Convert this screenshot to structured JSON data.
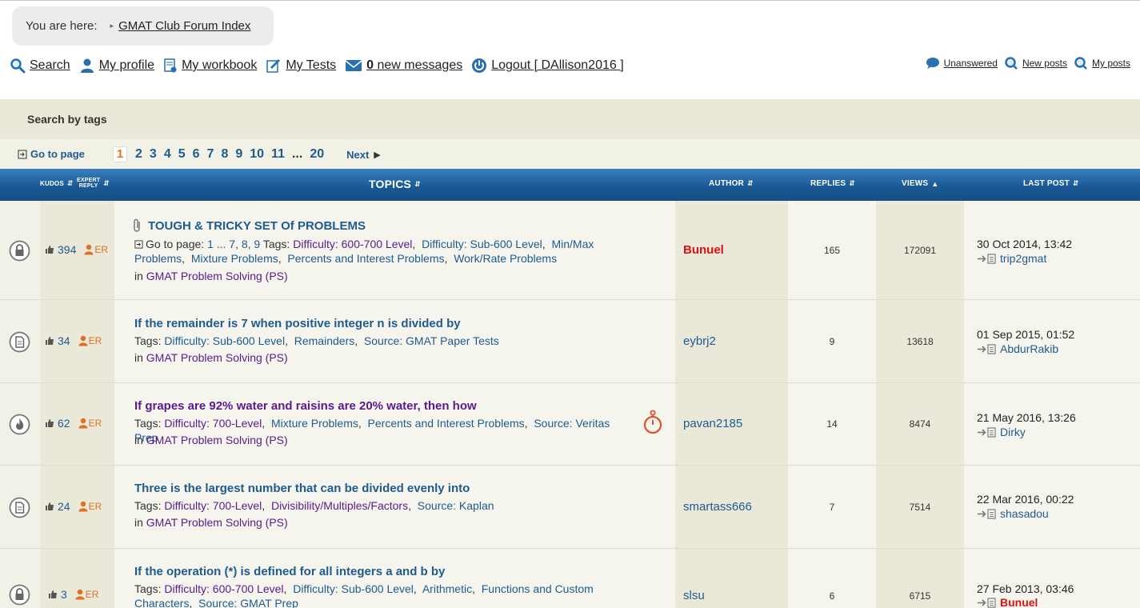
{
  "breadcrumb": {
    "prefix": "You are here:",
    "link": "GMAT Club Forum Index"
  },
  "nav": {
    "search": "Search",
    "profile": "My profile",
    "workbook": "My workbook",
    "tests": "My Tests",
    "messages_count": "0",
    "messages_label": "new messages",
    "logout": "Logout [ DAllison2016 ]"
  },
  "nav_right": {
    "unanswered": "Unanswered",
    "new_posts": "New posts",
    "my_posts": "My posts"
  },
  "search_tags_label": "Search by tags",
  "pager": {
    "goto_label": "Go to page",
    "current": "1",
    "pages": [
      "2",
      "3",
      "4",
      "5",
      "6",
      "7",
      "8",
      "9",
      "10",
      "11"
    ],
    "ellipsis": "...",
    "last": "20",
    "next": "Next"
  },
  "table_header": {
    "kudos": "KUDOS",
    "expert_reply_1": "EXPERT",
    "expert_reply_2": "REPLY",
    "topics": "TOPICS",
    "author": "AUTHOR",
    "replies": "REPLIES",
    "views": "VIEWS",
    "last_post": "LAST POST"
  },
  "rows": [
    {
      "kudos": "394",
      "er": "ER",
      "title": "TOUGH & TRICKY SET Of PROBLEMS",
      "goto_prefix": "Go to page:",
      "goto_pages": "1 ... 7, 8, 9",
      "tags_label": "Tags:",
      "tags": [
        "Difficulty: 600-700 Level",
        "Difficulty: Sub-600 Level",
        "Min/Max Problems",
        "Mixture Problems",
        "Percents and Interest Problems",
        "Work/Rate Problems"
      ],
      "forum_prefix": "in",
      "forum": "GMAT Problem Solving (PS)",
      "author": "Bunuel",
      "replies": "165",
      "views": "172091",
      "last_date": "30 Oct 2014, 13:42",
      "last_user": "trip2gmat"
    },
    {
      "kudos": "34",
      "er": "ER",
      "title": "If the remainder is 7 when positive integer n is divided by",
      "tags_label": "Tags:",
      "tags": [
        "Difficulty: Sub-600 Level",
        "Remainders",
        "Source: GMAT Paper Tests"
      ],
      "forum_prefix": "in",
      "forum": "GMAT Problem Solving (PS)",
      "author": "eybrj2",
      "replies": "9",
      "views": "13618",
      "last_date": "01 Sep 2015, 01:52",
      "last_user": "AbdurRakib"
    },
    {
      "kudos": "62",
      "er": "ER",
      "title": "If grapes are 92% water and raisins are 20% water, then how",
      "tags_label": "Tags:",
      "tags": [
        "Difficulty: 700-Level",
        "Mixture Problems",
        "Percents and Interest Problems",
        "Source: Veritas Prep"
      ],
      "forum_prefix": "in",
      "forum": "GMAT Problem Solving (PS)",
      "author": "pavan2185",
      "replies": "14",
      "views": "8474",
      "last_date": "21 May 2016, 13:26",
      "last_user": "Dirky"
    },
    {
      "kudos": "24",
      "er": "ER",
      "title": "Three is the largest number that can be divided evenly into",
      "tags_label": "Tags:",
      "tags": [
        "Difficulty: 700-Level",
        "Divisibility/Multiples/Factors",
        "Source: Kaplan"
      ],
      "forum_prefix": "in",
      "forum": "GMAT Problem Solving (PS)",
      "author": "smartass666",
      "replies": "7",
      "views": "7514",
      "last_date": "22 Mar 2016, 00:22",
      "last_user": "shasadou"
    },
    {
      "kudos": "3",
      "er": "ER",
      "title": "If the operation (*) is defined for all integers a and b by",
      "tags_label": "Tags:",
      "tags": [
        "Difficulty: 600-700 Level",
        "Difficulty: Sub-600 Level",
        "Arithmetic",
        "Functions and Custom Characters",
        "Source: GMAT Prep"
      ],
      "author": "slsu",
      "replies": "6",
      "views": "6715",
      "last_date": "27 Feb 2013, 03:46",
      "last_user": "Bunuel"
    }
  ]
}
